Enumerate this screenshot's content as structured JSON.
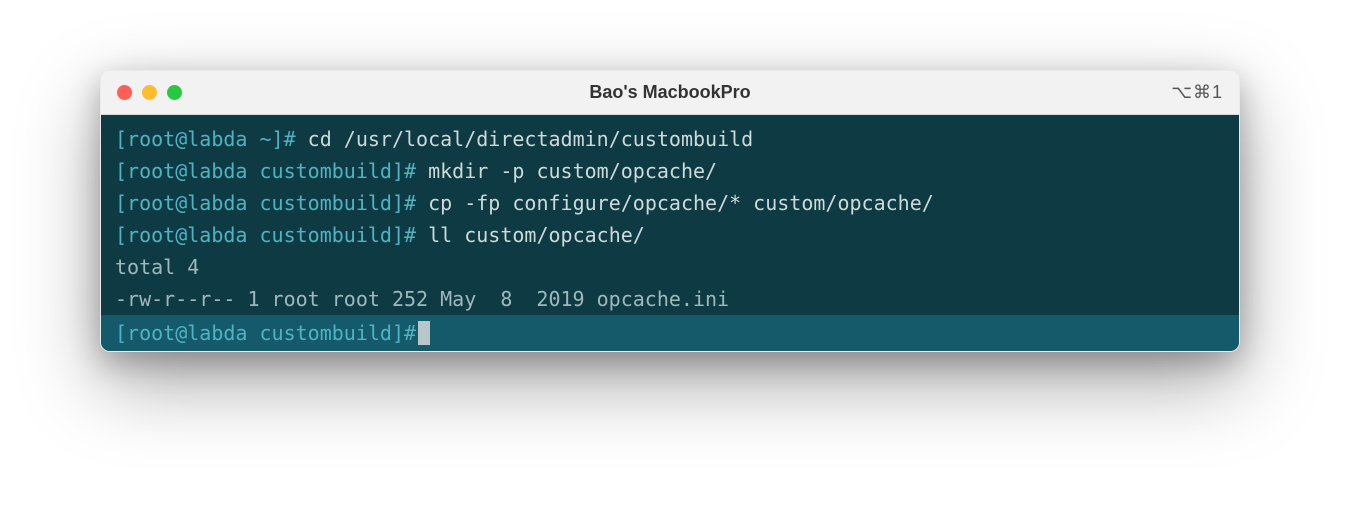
{
  "window": {
    "title": "Bao's MacbookPro",
    "shortcut": "⌥⌘1"
  },
  "terminal": {
    "lines": [
      {
        "prompt": "[root@labda ~]#",
        "command": "cd /usr/local/directadmin/custombuild"
      },
      {
        "prompt": "[root@labda custombuild]#",
        "command": "mkdir -p custom/opcache/"
      },
      {
        "prompt": "[root@labda custombuild]#",
        "command": "cp -fp configure/opcache/* custom/opcache/"
      },
      {
        "prompt": "[root@labda custombuild]#",
        "command": "ll custom/opcache/"
      }
    ],
    "output": [
      "total 4",
      "-rw-r--r-- 1 root root 252 May  8  2019 opcache.ini"
    ],
    "current_prompt": "[root@labda custombuild]#"
  }
}
